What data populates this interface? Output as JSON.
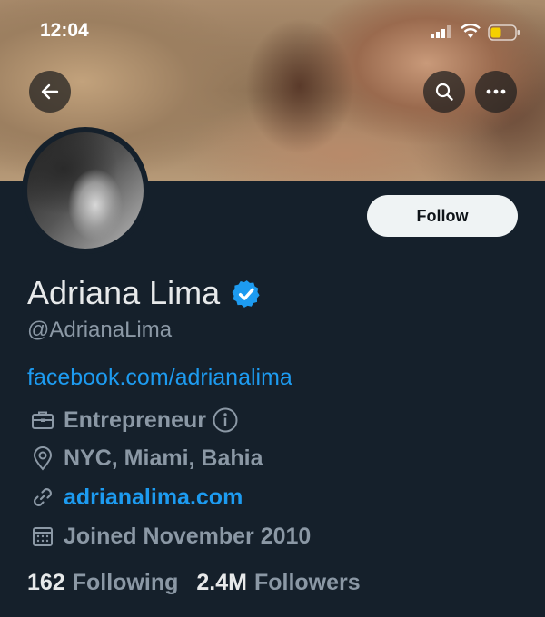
{
  "status_bar": {
    "time": "12:04"
  },
  "profile": {
    "name": "Adriana Lima",
    "handle": "@AdrianaLima",
    "bio_link": "facebook.com/adrianalima",
    "category": "Entrepreneur",
    "location": "NYC, Miami, Bahia",
    "website": "adrianalima.com",
    "joined": "Joined November 2010",
    "following_count": "162",
    "following_label": "Following",
    "followers_count": "2.4M",
    "followers_label": "Followers"
  },
  "actions": {
    "follow_label": "Follow"
  },
  "colors": {
    "background": "#15202b",
    "accent": "#1d9bf0",
    "muted": "#8b98a5",
    "text": "#e7e9ea"
  },
  "icons": [
    "back-arrow-icon",
    "search-icon",
    "more-icon",
    "verified-badge-icon",
    "briefcase-icon",
    "info-icon",
    "location-pin-icon",
    "link-icon",
    "calendar-icon"
  ]
}
